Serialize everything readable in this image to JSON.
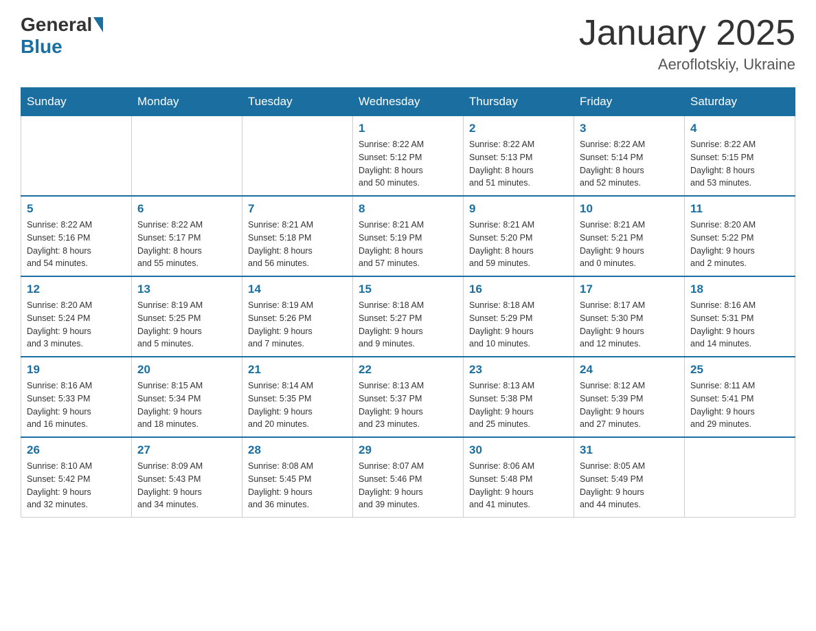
{
  "header": {
    "logo_general": "General",
    "logo_blue": "Blue",
    "month_title": "January 2025",
    "location": "Aeroflotskiy, Ukraine"
  },
  "days_of_week": [
    "Sunday",
    "Monday",
    "Tuesday",
    "Wednesday",
    "Thursday",
    "Friday",
    "Saturday"
  ],
  "weeks": [
    [
      {
        "day": "",
        "info": ""
      },
      {
        "day": "",
        "info": ""
      },
      {
        "day": "",
        "info": ""
      },
      {
        "day": "1",
        "info": "Sunrise: 8:22 AM\nSunset: 5:12 PM\nDaylight: 8 hours\nand 50 minutes."
      },
      {
        "day": "2",
        "info": "Sunrise: 8:22 AM\nSunset: 5:13 PM\nDaylight: 8 hours\nand 51 minutes."
      },
      {
        "day": "3",
        "info": "Sunrise: 8:22 AM\nSunset: 5:14 PM\nDaylight: 8 hours\nand 52 minutes."
      },
      {
        "day": "4",
        "info": "Sunrise: 8:22 AM\nSunset: 5:15 PM\nDaylight: 8 hours\nand 53 minutes."
      }
    ],
    [
      {
        "day": "5",
        "info": "Sunrise: 8:22 AM\nSunset: 5:16 PM\nDaylight: 8 hours\nand 54 minutes."
      },
      {
        "day": "6",
        "info": "Sunrise: 8:22 AM\nSunset: 5:17 PM\nDaylight: 8 hours\nand 55 minutes."
      },
      {
        "day": "7",
        "info": "Sunrise: 8:21 AM\nSunset: 5:18 PM\nDaylight: 8 hours\nand 56 minutes."
      },
      {
        "day": "8",
        "info": "Sunrise: 8:21 AM\nSunset: 5:19 PM\nDaylight: 8 hours\nand 57 minutes."
      },
      {
        "day": "9",
        "info": "Sunrise: 8:21 AM\nSunset: 5:20 PM\nDaylight: 8 hours\nand 59 minutes."
      },
      {
        "day": "10",
        "info": "Sunrise: 8:21 AM\nSunset: 5:21 PM\nDaylight: 9 hours\nand 0 minutes."
      },
      {
        "day": "11",
        "info": "Sunrise: 8:20 AM\nSunset: 5:22 PM\nDaylight: 9 hours\nand 2 minutes."
      }
    ],
    [
      {
        "day": "12",
        "info": "Sunrise: 8:20 AM\nSunset: 5:24 PM\nDaylight: 9 hours\nand 3 minutes."
      },
      {
        "day": "13",
        "info": "Sunrise: 8:19 AM\nSunset: 5:25 PM\nDaylight: 9 hours\nand 5 minutes."
      },
      {
        "day": "14",
        "info": "Sunrise: 8:19 AM\nSunset: 5:26 PM\nDaylight: 9 hours\nand 7 minutes."
      },
      {
        "day": "15",
        "info": "Sunrise: 8:18 AM\nSunset: 5:27 PM\nDaylight: 9 hours\nand 9 minutes."
      },
      {
        "day": "16",
        "info": "Sunrise: 8:18 AM\nSunset: 5:29 PM\nDaylight: 9 hours\nand 10 minutes."
      },
      {
        "day": "17",
        "info": "Sunrise: 8:17 AM\nSunset: 5:30 PM\nDaylight: 9 hours\nand 12 minutes."
      },
      {
        "day": "18",
        "info": "Sunrise: 8:16 AM\nSunset: 5:31 PM\nDaylight: 9 hours\nand 14 minutes."
      }
    ],
    [
      {
        "day": "19",
        "info": "Sunrise: 8:16 AM\nSunset: 5:33 PM\nDaylight: 9 hours\nand 16 minutes."
      },
      {
        "day": "20",
        "info": "Sunrise: 8:15 AM\nSunset: 5:34 PM\nDaylight: 9 hours\nand 18 minutes."
      },
      {
        "day": "21",
        "info": "Sunrise: 8:14 AM\nSunset: 5:35 PM\nDaylight: 9 hours\nand 20 minutes."
      },
      {
        "day": "22",
        "info": "Sunrise: 8:13 AM\nSunset: 5:37 PM\nDaylight: 9 hours\nand 23 minutes."
      },
      {
        "day": "23",
        "info": "Sunrise: 8:13 AM\nSunset: 5:38 PM\nDaylight: 9 hours\nand 25 minutes."
      },
      {
        "day": "24",
        "info": "Sunrise: 8:12 AM\nSunset: 5:39 PM\nDaylight: 9 hours\nand 27 minutes."
      },
      {
        "day": "25",
        "info": "Sunrise: 8:11 AM\nSunset: 5:41 PM\nDaylight: 9 hours\nand 29 minutes."
      }
    ],
    [
      {
        "day": "26",
        "info": "Sunrise: 8:10 AM\nSunset: 5:42 PM\nDaylight: 9 hours\nand 32 minutes."
      },
      {
        "day": "27",
        "info": "Sunrise: 8:09 AM\nSunset: 5:43 PM\nDaylight: 9 hours\nand 34 minutes."
      },
      {
        "day": "28",
        "info": "Sunrise: 8:08 AM\nSunset: 5:45 PM\nDaylight: 9 hours\nand 36 minutes."
      },
      {
        "day": "29",
        "info": "Sunrise: 8:07 AM\nSunset: 5:46 PM\nDaylight: 9 hours\nand 39 minutes."
      },
      {
        "day": "30",
        "info": "Sunrise: 8:06 AM\nSunset: 5:48 PM\nDaylight: 9 hours\nand 41 minutes."
      },
      {
        "day": "31",
        "info": "Sunrise: 8:05 AM\nSunset: 5:49 PM\nDaylight: 9 hours\nand 44 minutes."
      },
      {
        "day": "",
        "info": ""
      }
    ]
  ]
}
